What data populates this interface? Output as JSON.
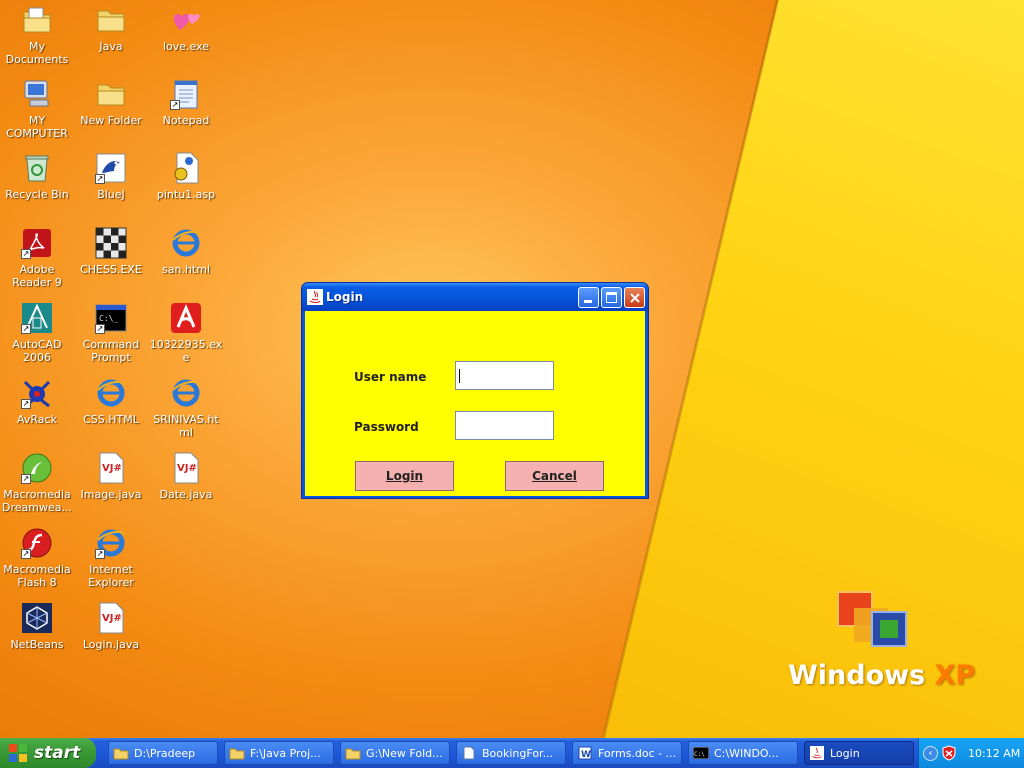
{
  "desktop": {
    "icons": [
      {
        "label": "My Documents",
        "icon": "my-documents-icon"
      },
      {
        "label": "Java",
        "icon": "folder-icon"
      },
      {
        "label": "love.exe",
        "icon": "hearts-icon"
      },
      {
        "label": "MY COMPUTER",
        "icon": "my-computer-icon"
      },
      {
        "label": "New Folder",
        "icon": "folder-icon"
      },
      {
        "label": "Notepad",
        "icon": "notepad-icon"
      },
      {
        "label": "Recycle Bin",
        "icon": "recycle-bin-icon"
      },
      {
        "label": "BlueJ",
        "icon": "bluej-icon"
      },
      {
        "label": "pintu1.asp",
        "icon": "asp-file-icon"
      },
      {
        "label": "Adobe Reader 9",
        "icon": "adobe-reader-icon"
      },
      {
        "label": "CHESS.EXE",
        "icon": "chess-icon"
      },
      {
        "label": "san.html",
        "icon": "ie-document-icon"
      },
      {
        "label": "AutoCAD 2006",
        "icon": "autocad-icon"
      },
      {
        "label": "Command Prompt",
        "icon": "command-prompt-icon"
      },
      {
        "label": "10322935.exe",
        "icon": "avira-icon"
      },
      {
        "label": "AvRack",
        "icon": "avrack-icon"
      },
      {
        "label": "CSS.HTML",
        "icon": "ie-document-icon"
      },
      {
        "label": "SRINIVAS.html",
        "icon": "ie-document-icon"
      },
      {
        "label": "Macromedia Dreamwea...",
        "icon": "dreamweaver-icon"
      },
      {
        "label": "Image.java",
        "icon": "vj-file-icon"
      },
      {
        "label": "Date.java",
        "icon": "vj-file-icon"
      },
      {
        "label": "Macromedia Flash 8",
        "icon": "flash-icon"
      },
      {
        "label": "Internet Explorer",
        "icon": "internet-explorer-icon"
      },
      {
        "label": "NetBeans",
        "icon": "netbeans-icon"
      },
      {
        "label": "Login.java",
        "icon": "vj-file-icon"
      }
    ],
    "logo_text_main": "Windows",
    "logo_text_accent": "XP"
  },
  "login_window": {
    "title": "Login",
    "username_label": "User name",
    "password_label": "Password",
    "username_value": "",
    "password_value": "",
    "login_button": "Login",
    "cancel_button": "Cancel",
    "client_color": "#ffff00",
    "button_color": "#f5b0b0"
  },
  "taskbar": {
    "start_label": "start",
    "buttons": [
      {
        "label": "D:\\Pradeep",
        "icon": "folder-icon"
      },
      {
        "label": "F:\\Java Proj...",
        "icon": "folder-icon"
      },
      {
        "label": "G:\\New Fold...",
        "icon": "folder-icon"
      },
      {
        "label": "BookingFor...",
        "icon": "document-icon"
      },
      {
        "label": "Forms.doc - ...",
        "icon": "word-icon"
      },
      {
        "label": "C:\\WINDO...",
        "icon": "command-prompt-icon"
      },
      {
        "label": "Login",
        "icon": "java-icon",
        "active": true
      }
    ],
    "clock": "10:12 AM"
  }
}
